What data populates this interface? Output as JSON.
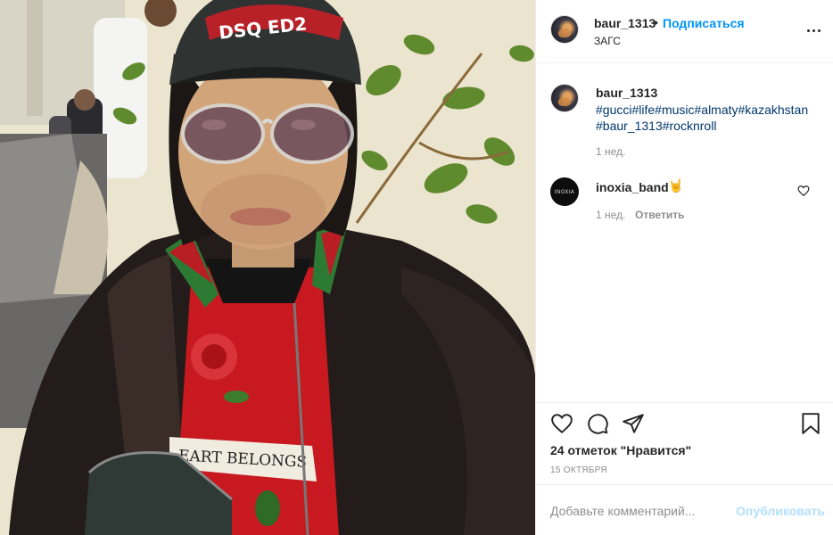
{
  "photo": {
    "shirt_text": "EART BELONGS",
    "cap_text": "DSQ ED2"
  },
  "header": {
    "username": "baur_1313",
    "separator": "•",
    "follow_label": "Подписаться",
    "location": "ЗАГС",
    "more_icon": "more-horizontal-icon"
  },
  "caption": {
    "username": "baur_1313",
    "hashtags": "#gucci#life#music#almaty#kazakhstan #baur_1313#rocknroll",
    "time": "1 нед."
  },
  "comment": {
    "avatar_text": "INOXIA",
    "username": "inoxia_band",
    "emoji": "🤘",
    "time": "1 нед.",
    "reply_label": "Ответить"
  },
  "actions": {
    "icons": [
      "heart-icon",
      "comment-icon",
      "share-icon",
      "bookmark-icon"
    ],
    "likes": "24 отметок \"Нравится\"",
    "date": "15 ОКТЯБРЯ"
  },
  "add_comment": {
    "placeholder": "Добавьте комментарий...",
    "publish_label": "Опубликовать"
  },
  "colors": {
    "accent": "#0095f6",
    "hashtag": "#00376b",
    "muted": "#8e8e8e",
    "publish_disabled": "#b2dffc"
  }
}
